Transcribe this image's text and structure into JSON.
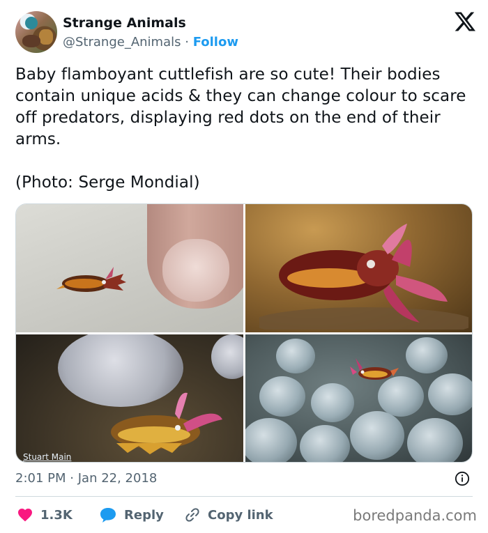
{
  "author": {
    "name": "Strange Animals",
    "handle": "@Strange_Animals",
    "separator": "·",
    "follow_label": "Follow"
  },
  "tweet": {
    "text": "Baby flamboyant cuttlefish are so cute! Their bodies contain unique acids & they can change colour to scare off predators, displaying red dots on the end of their arms.\n\n(Photo: Serge Mondial)"
  },
  "media": {
    "photo_credit_watermark": "Stuart Main"
  },
  "meta": {
    "time": "2:01 PM",
    "separator": "·",
    "date": "Jan 22, 2018"
  },
  "actions": {
    "like_count": "1.3K",
    "reply_label": "Reply",
    "copy_link_label": "Copy link"
  },
  "footer": {
    "brand": "boredpanda.com"
  },
  "colors": {
    "link": "#1d9bf0",
    "heart": "#f91880",
    "reply_bubble": "#1d9bf0",
    "muted_text": "#536471"
  },
  "icons": [
    "x-logo-icon",
    "info-icon",
    "heart-icon",
    "reply-bubble-icon",
    "link-icon"
  ]
}
